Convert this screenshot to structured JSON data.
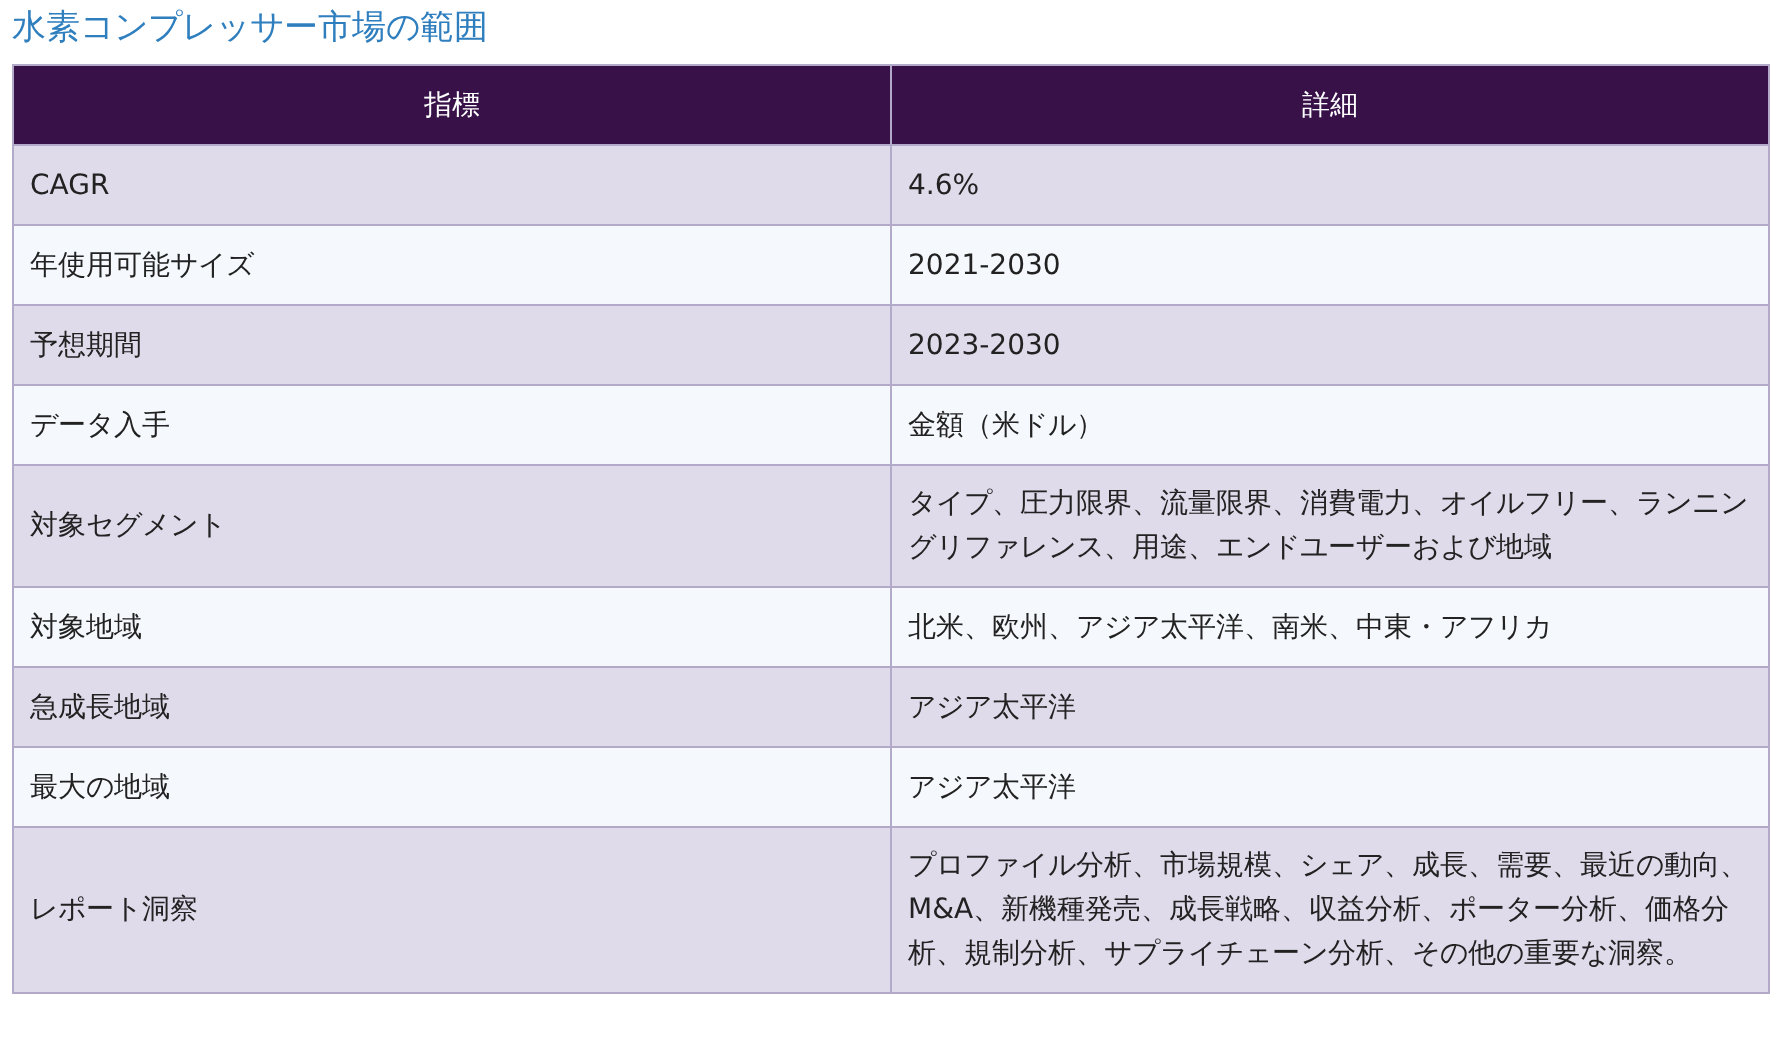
{
  "title": "水素コンプレッサー市場の範囲",
  "table": {
    "columns": [
      "指標",
      "詳細"
    ],
    "rows": [
      [
        "CAGR",
        "4.6%"
      ],
      [
        "年使用可能サイズ",
        "2021-2030"
      ],
      [
        "予想期間",
        "2023-2030"
      ],
      [
        "データ入手",
        "金額（米ドル）"
      ],
      [
        "対象セグメント",
        "タイプ、圧力限界、流量限界、消費電力、オイルフリー、ランニングリファレンス、用途、エンドユーザーおよび地域"
      ],
      [
        "対象地域",
        "北米、欧州、アジア太平洋、南米、中東・アフリカ"
      ],
      [
        "急成長地域",
        "アジア太平洋"
      ],
      [
        "最大の地域",
        "アジア太平洋"
      ],
      [
        "レポート洞察",
        "プロファイル分析、市場規模、シェア、成長、需要、最近の動向、M&A、新機種発売、成長戦略、収益分析、ポーター分析、価格分析、規制分析、サプライチェーン分析、その他の重要な洞察。"
      ]
    ]
  }
}
